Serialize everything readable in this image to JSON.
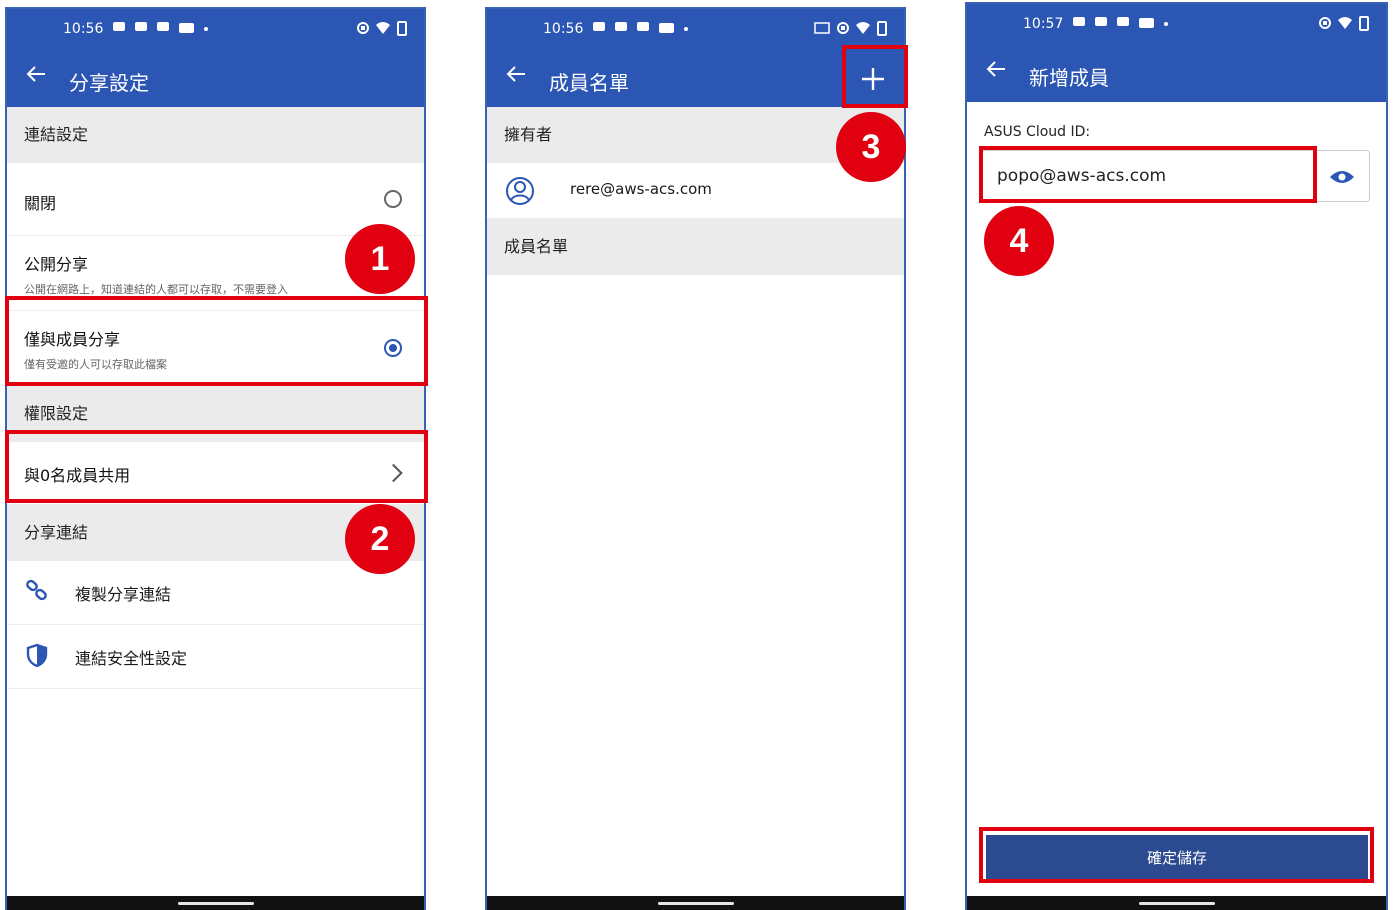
{
  "screen1": {
    "status_time": "10:56",
    "title": "分享設定",
    "section_link": "連結設定",
    "option_off": "關閉",
    "option_public": "公開分享",
    "option_public_desc": "公開在網路上，知道連結的人都可以存取，不需要登入",
    "option_members": "僅與成員分享",
    "option_members_desc": "僅有受邀的人可以存取此檔案",
    "selected_option": "option_members",
    "section_permission": "權限設定",
    "share_with": "與0名成員共用",
    "section_share_link": "分享連結",
    "copy_link": "複製分享連結",
    "link_security": "連結安全性設定",
    "badge_1": "1",
    "badge_2": "2"
  },
  "screen2": {
    "status_time": "10:56",
    "title": "成員名單",
    "section_owner": "擁有者",
    "owner_email": "rere@aws-acs.com",
    "section_members": "成員名單",
    "badge_3": "3"
  },
  "screen3": {
    "status_time": "10:57",
    "title": "新增成員",
    "field_label": "ASUS Cloud ID:",
    "field_value": "popo@aws-acs.com",
    "save_button": "確定儲存",
    "badge_4": "4"
  },
  "colors": {
    "accent": "#2c56b3",
    "save_button": "#2c4a8f",
    "highlight": "#e00010"
  },
  "icons": {
    "back": "arrow-left-icon",
    "add": "plus-icon",
    "user": "user-circle-icon",
    "link": "link-icon",
    "shield": "shield-icon",
    "eye": "eye-icon",
    "chevron": "chevron-right-icon"
  }
}
